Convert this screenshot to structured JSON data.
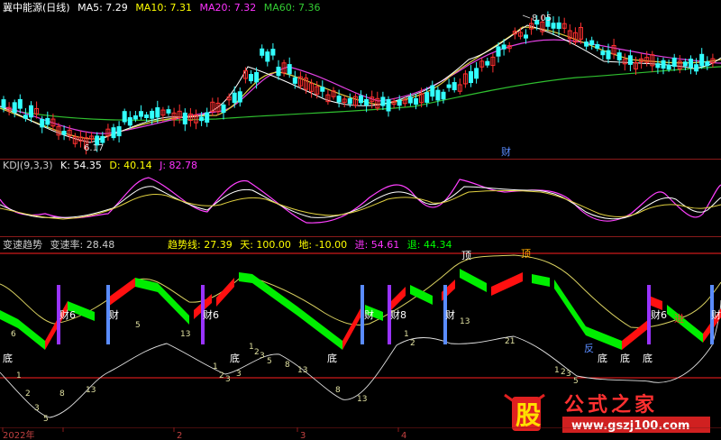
{
  "main": {
    "title": "冀中能源(日线)",
    "ma": [
      {
        "label": "MA5: 7.29",
        "color": "#ffffff"
      },
      {
        "label": "MA10: 7.31",
        "color": "#ffff00"
      },
      {
        "label": "MA20: 7.32",
        "color": "#ff33ff"
      },
      {
        "label": "MA60: 7.36",
        "color": "#33cc33"
      }
    ],
    "high_label": "8.05",
    "low_label": "6.17",
    "cai_label": "财"
  },
  "kdj": {
    "title": "KDJ(9,3,3)",
    "k": "K: 54.35",
    "d": "D: 40.14",
    "j": "J: 82.78"
  },
  "bs": {
    "title": "变速趋势",
    "rate": "变速率: 28.48",
    "trend": "趋势线: 27.39",
    "tian": "天: 100.00",
    "di": "地: -10.00",
    "jin": "进: 54.61",
    "tui": "退: 44.34",
    "marks": {
      "cai6": "财6",
      "cai": "财",
      "cai8": "财8",
      "ding": "顶",
      "fan": "反",
      "di": "底",
      "jin": "进"
    }
  },
  "axis": {
    "year": "2022年",
    "months": [
      "2",
      "3",
      "4"
    ]
  },
  "watermark": {
    "logo": "股",
    "title": "公式之家",
    "url": "www.gszj100.com"
  },
  "colors": {
    "up": "#ff3030",
    "down": "#33ffff",
    "green": "#00ee00",
    "red": "#ff0000"
  }
}
